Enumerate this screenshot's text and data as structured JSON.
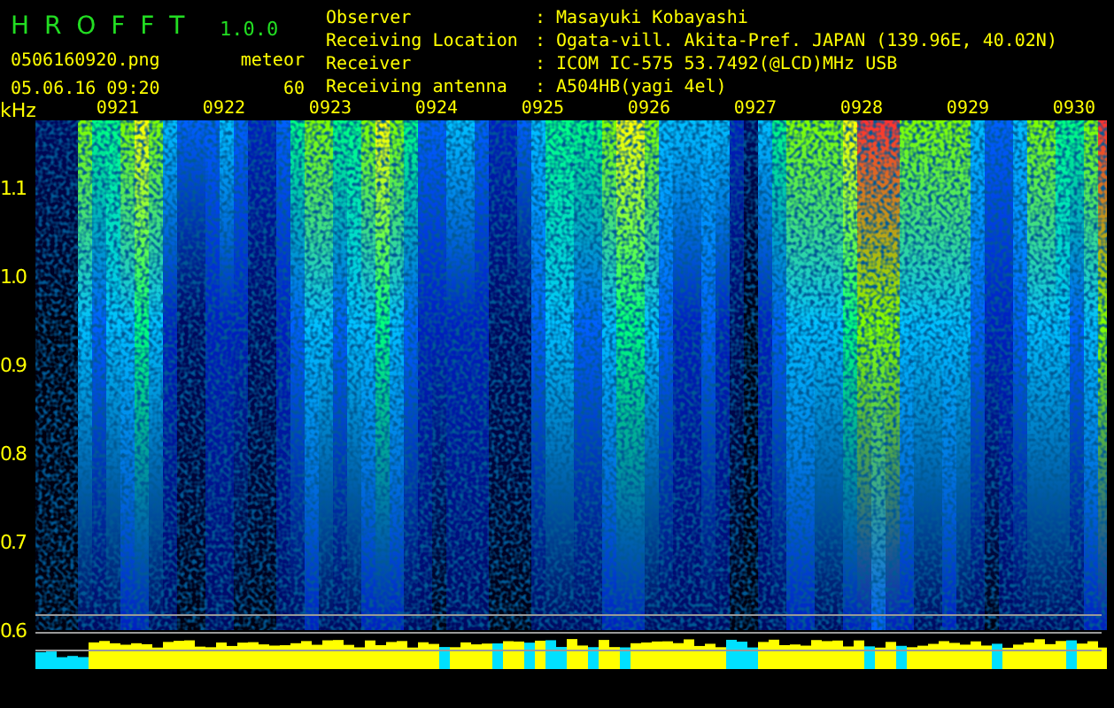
{
  "header": {
    "app_name": "H R O F F T",
    "version": "1.0.0",
    "filename": "0506160920.png",
    "mode": "meteor",
    "timestamp": "05.06.16 09:20",
    "count": "60"
  },
  "info": [
    {
      "label": "Observer",
      "separator": ":",
      "value": "Masayuki Kobayashi"
    },
    {
      "label": "Receiving Location",
      "separator": ":",
      "value": "Ogata-vill. Akita-Pref. JAPAN (139.96E, 40.02N)"
    },
    {
      "label": "Receiver",
      "separator": ":",
      "value": "ICOM IC-575 53.7492(@LCD)MHz USB"
    },
    {
      "label": "Receiving antenna",
      "separator": ":",
      "value": "A504HB(yagi 4el)"
    }
  ],
  "plot": {
    "unit": "kHz",
    "y_labels": [
      "1.1",
      "1.0",
      "0.9",
      "0.8",
      "0.7",
      "0.6"
    ],
    "time_labels": [
      "0921",
      "0922",
      "0923",
      "0924",
      "0925",
      "0926",
      "0927",
      "0928",
      "0929",
      "0930"
    ]
  }
}
